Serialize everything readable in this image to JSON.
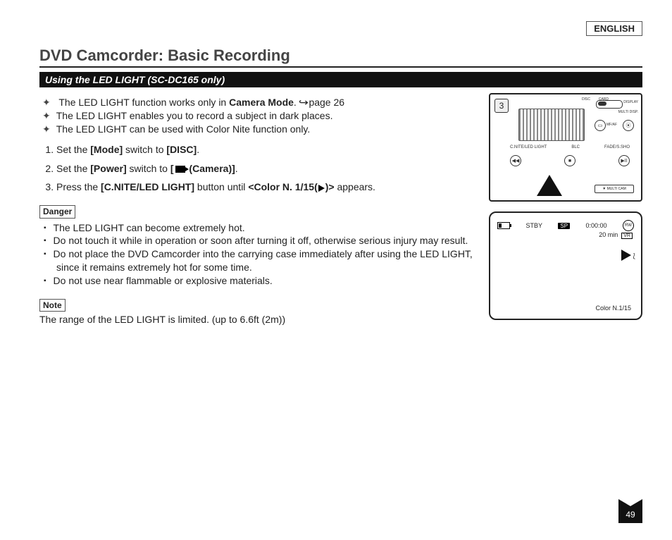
{
  "language_label": "ENGLISH",
  "title": "DVD Camcorder: Basic Recording",
  "subtitle": "Using the LED LIGHT (SC-DC165 only)",
  "intro_bullets": [
    {
      "pre": "The LED LIGHT function works only in ",
      "bold": "Camera Mode",
      "post": ". ",
      "ref": "page 26"
    },
    {
      "pre": "The LED LIGHT enables you to record a subject in dark places.",
      "bold": "",
      "post": "",
      "ref": ""
    },
    {
      "pre": "The LED LIGHT can be used with Color Nite function only.",
      "bold": "",
      "post": "",
      "ref": ""
    }
  ],
  "steps": [
    {
      "pre": "Set the ",
      "b1": "[Mode]",
      "mid": " switch to ",
      "b2": "[DISC]",
      "post": "."
    },
    {
      "pre": "Set the ",
      "b1": "[Power]",
      "mid": " switch to ",
      "b2_pre": "[",
      "b2_post": " (Camera)]",
      "cam": true,
      "post": "."
    },
    {
      "pre": "Press the ",
      "b1": "[C.NITE/LED LIGHT]",
      "mid": " button until ",
      "b2_pre": "<Color N. 1/15(",
      "b2_post": ")>",
      "light": true,
      "post": " appears."
    }
  ],
  "danger_label": "Danger",
  "danger_items": [
    "The LED LIGHT can become extremely hot.",
    "Do not touch it while in operation or soon after turning it off, otherwise serious injury may result.",
    "Do not place the DVD Camcorder into the carrying case immediately after using the LED LIGHT, since it remains extremely hot for some time.",
    "Do not use near flammable or explosive materials."
  ],
  "note_label": "Note",
  "note_text": "The range of the LED LIGHT is limited. (up to 6.6ft (2m))",
  "diagram": {
    "step_num": "3",
    "labels": {
      "disc": "DISC",
      "card": "CARD",
      "display": "DISPLAY",
      "multi_disp": "MULTI DISP.",
      "mfaf": "MF/AF",
      "cnite": "C.NITE/LED LIGHT",
      "blc": "BLC",
      "fade": "FADE/S.SHO",
      "multicam": "▼ MULTI CAM"
    }
  },
  "screen": {
    "stby": "STBY",
    "sp": "SP",
    "time": "0:00:00",
    "rw": "RW",
    "remain": "20 min",
    "vr": "VR",
    "color_nite": "Color N.1/15"
  },
  "page_number": "49"
}
